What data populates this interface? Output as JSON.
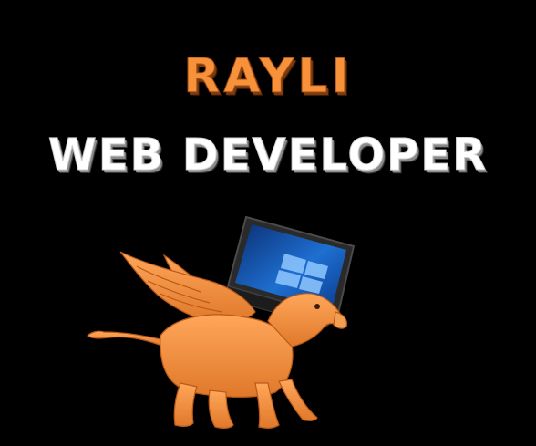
{
  "header": {
    "name": "RAYLI",
    "role": "WEB DEVELOPER"
  },
  "colors": {
    "background": "#000000",
    "name_fill": "#f7913a",
    "role_fill": "#ffffff",
    "griffin": "#f7913a",
    "laptop_screen": "#1e6fd1"
  },
  "illustration": {
    "subject_icon": "griffin-icon",
    "device_icon": "laptop-icon"
  }
}
